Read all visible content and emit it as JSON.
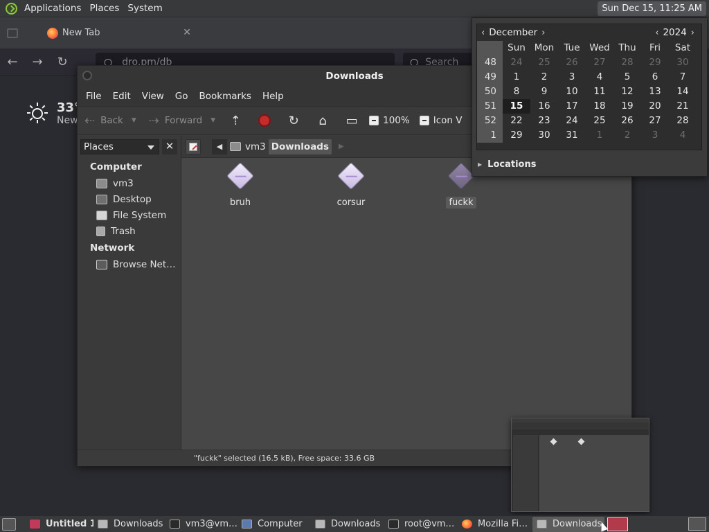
{
  "top_panel": {
    "menus": [
      "Applications",
      "Places",
      "System"
    ],
    "clock": "Sun Dec 15, 11:25 AM"
  },
  "browser": {
    "tab_title": "New Tab",
    "url": "dro.pm/db",
    "search_placeholder": "Search",
    "weather_temp": "33°",
    "weather_loc": "New"
  },
  "caja": {
    "title": "Downloads",
    "menu": [
      "File",
      "Edit",
      "View",
      "Go",
      "Bookmarks",
      "Help"
    ],
    "toolbar": {
      "back": "Back",
      "forward": "Forward",
      "zoom": "100%",
      "view_mode": "Icon V"
    },
    "sidebar": {
      "combo": "Places",
      "sections": [
        {
          "heading": "Computer",
          "items": [
            "vm3",
            "Desktop",
            "File System",
            "Trash"
          ]
        },
        {
          "heading": "Network",
          "items": [
            "Browse Net…"
          ]
        }
      ]
    },
    "pathbar": [
      "vm3",
      "Downloads"
    ],
    "files": [
      "bruh",
      "corsur",
      "fuckk"
    ],
    "status": "\"fuckk\" selected (16.5 kB), Free space: 33.6 GB"
  },
  "calendar": {
    "month": "December",
    "year": "2024",
    "day_names": [
      "Sun",
      "Mon",
      "Tue",
      "Wed",
      "Thu",
      "Fri",
      "Sat"
    ],
    "weeks": [
      {
        "wk": "48",
        "days": [
          "24",
          "25",
          "26",
          "27",
          "28",
          "29",
          "30"
        ],
        "dim": [
          true,
          true,
          true,
          true,
          true,
          true,
          true
        ]
      },
      {
        "wk": "49",
        "days": [
          "1",
          "2",
          "3",
          "4",
          "5",
          "6",
          "7"
        ],
        "dim": [
          false,
          false,
          false,
          false,
          false,
          false,
          false
        ]
      },
      {
        "wk": "50",
        "days": [
          "8",
          "9",
          "10",
          "11",
          "12",
          "13",
          "14"
        ],
        "dim": [
          false,
          false,
          false,
          false,
          false,
          false,
          false
        ]
      },
      {
        "wk": "51",
        "days": [
          "15",
          "16",
          "17",
          "18",
          "19",
          "20",
          "21"
        ],
        "dim": [
          false,
          false,
          false,
          false,
          false,
          false,
          false
        ]
      },
      {
        "wk": "52",
        "days": [
          "22",
          "23",
          "24",
          "25",
          "26",
          "27",
          "28"
        ],
        "dim": [
          false,
          false,
          false,
          false,
          false,
          false,
          false
        ]
      },
      {
        "wk": "1",
        "days": [
          "29",
          "30",
          "31",
          "1",
          "2",
          "3",
          "4"
        ],
        "dim": [
          false,
          false,
          false,
          true,
          true,
          true,
          true
        ]
      }
    ],
    "today": "15",
    "locations": "Locations"
  },
  "taskbar": [
    {
      "label": "Untitled 1…",
      "icon": "text",
      "bold": true
    },
    {
      "label": "Downloads",
      "icon": "folder"
    },
    {
      "label": "vm3@vm…",
      "icon": "term"
    },
    {
      "label": "Computer",
      "icon": "comp"
    },
    {
      "label": "Downloads",
      "icon": "folder"
    },
    {
      "label": "root@vm…",
      "icon": "term"
    },
    {
      "label": "Mozilla Fi…",
      "icon": "ff"
    },
    {
      "label": "Downloads",
      "icon": "folder",
      "active": true
    }
  ]
}
